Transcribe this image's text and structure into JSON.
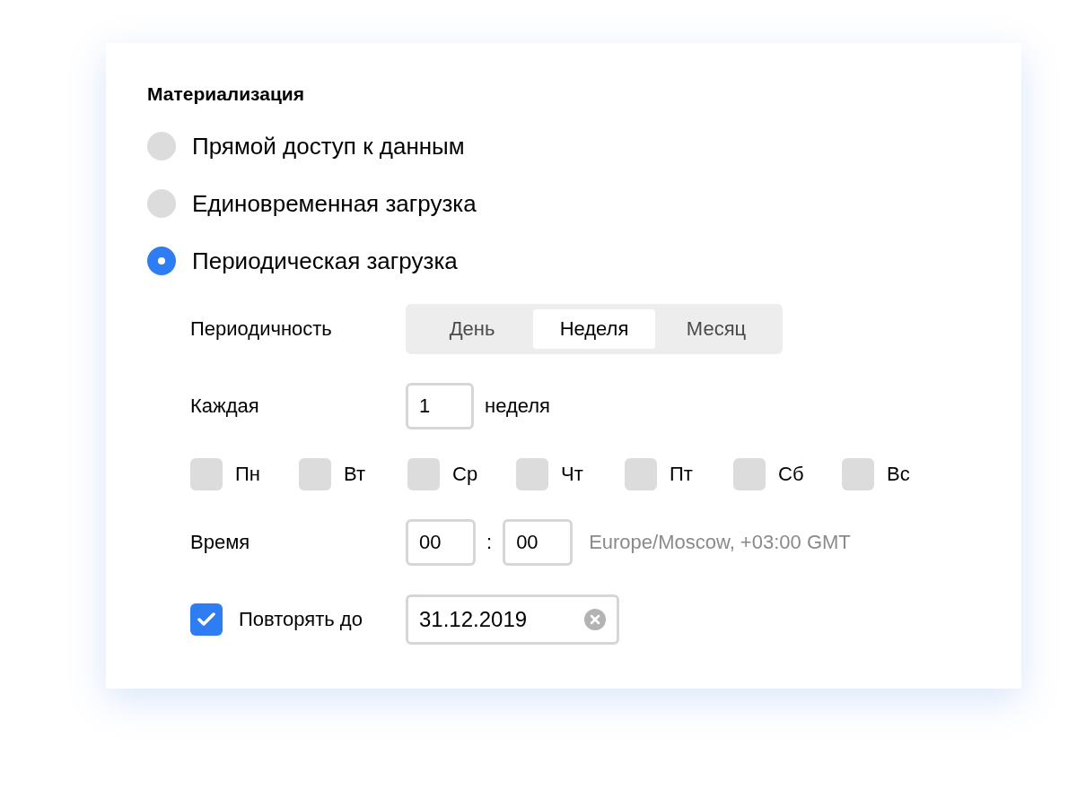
{
  "section": {
    "title": "Материализация"
  },
  "modes": [
    {
      "label": "Прямой доступ к данным",
      "selected": false
    },
    {
      "label": "Единовременная загрузка",
      "selected": false
    },
    {
      "label": "Периодическая загрузка",
      "selected": true
    }
  ],
  "periodicity": {
    "label": "Периодичность",
    "options": [
      {
        "label": "День",
        "selected": false
      },
      {
        "label": "Неделя",
        "selected": true
      },
      {
        "label": "Месяц",
        "selected": false
      }
    ]
  },
  "every": {
    "label": "Каждая",
    "value": "1",
    "unit": "неделя"
  },
  "days": [
    {
      "label": "Пн",
      "checked": false
    },
    {
      "label": "Вт",
      "checked": false
    },
    {
      "label": "Ср",
      "checked": false
    },
    {
      "label": "Чт",
      "checked": false
    },
    {
      "label": "Пт",
      "checked": false
    },
    {
      "label": "Сб",
      "checked": false
    },
    {
      "label": "Вс",
      "checked": false
    }
  ],
  "time": {
    "label": "Время",
    "hours": "00",
    "separator": ":",
    "minutes": "00",
    "timezone": "Europe/Moscow, +03:00 GMT"
  },
  "repeat_until": {
    "label": "Повторять до",
    "checked": true,
    "value": "31.12.2019"
  }
}
